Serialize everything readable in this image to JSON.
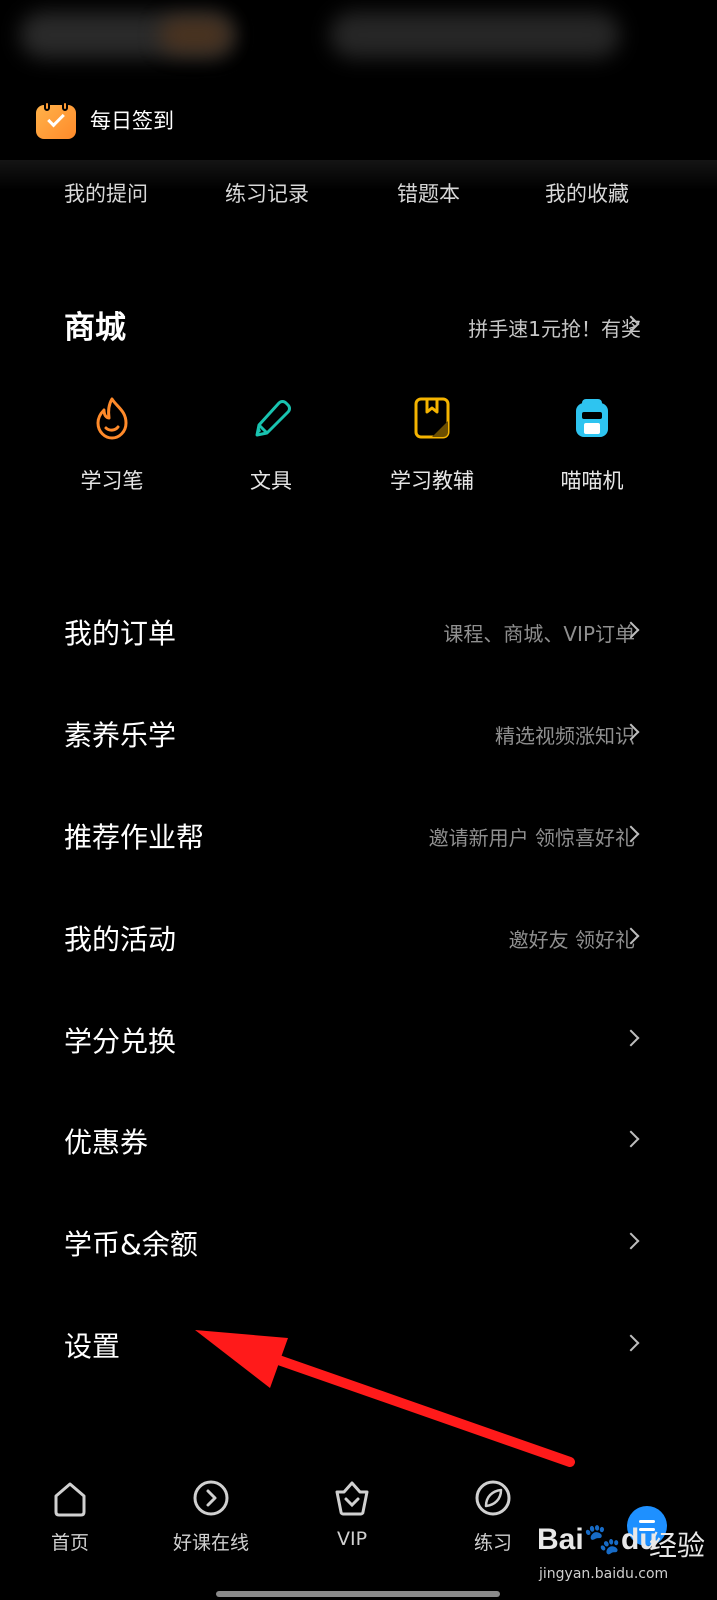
{
  "checkin": {
    "label": "每日签到"
  },
  "quick_links": [
    "我的提问",
    "练习记录",
    "错题本",
    "我的收藏"
  ],
  "mall": {
    "title": "商城",
    "promo": "拼手速1元抢！有奖",
    "items": [
      {
        "label": "学习笔",
        "icon": "flame-icon"
      },
      {
        "label": "文具",
        "icon": "pencil-icon"
      },
      {
        "label": "学习教辅",
        "icon": "book-icon"
      },
      {
        "label": "喵喵机",
        "icon": "printer-icon"
      }
    ]
  },
  "menu": [
    {
      "title": "我的订单",
      "sub": "课程、商城、VIP订单"
    },
    {
      "title": "素养乐学",
      "sub": "精选视频涨知识"
    },
    {
      "title": "推荐作业帮",
      "sub": "邀请新用户 领惊喜好礼"
    },
    {
      "title": "我的活动",
      "sub": "邀好友 领好礼"
    },
    {
      "title": "学分兑换",
      "sub": ""
    },
    {
      "title": "优惠券",
      "sub": ""
    },
    {
      "title": "学币&余额",
      "sub": ""
    },
    {
      "title": "设置",
      "sub": ""
    }
  ],
  "bottom_nav": [
    {
      "label": "首页",
      "icon": "home-icon"
    },
    {
      "label": "好课在线",
      "icon": "play-icon"
    },
    {
      "label": "VIP",
      "icon": "vip-basket-icon"
    },
    {
      "label": "练习",
      "icon": "leaf-icon"
    }
  ],
  "watermark": {
    "logo_left": "Bai",
    "logo_right": "du",
    "jingyan": "经验",
    "url": "jingyan.baidu.com"
  },
  "colors": {
    "accent_orange": "#ff8a2a",
    "accent_teal": "#19c3b0",
    "accent_yellow": "#f5b400",
    "accent_cyan": "#2ec4f0",
    "arrow_red": "#ff1a1a"
  }
}
